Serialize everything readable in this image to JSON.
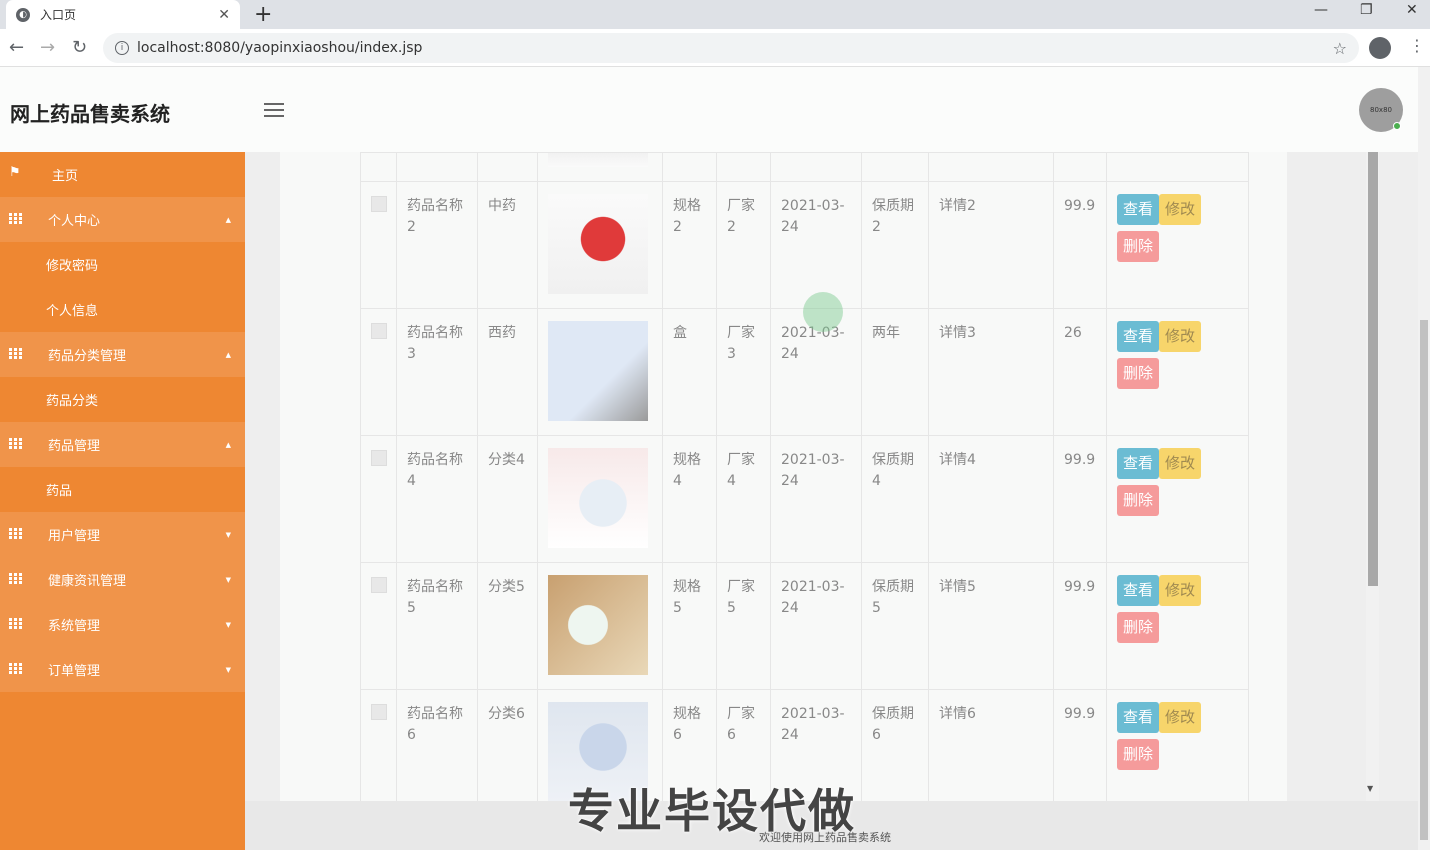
{
  "browser": {
    "tab_title": "入口页",
    "url": "localhost:8080/yaopinxiaoshou/index.jsp"
  },
  "header": {
    "app_title": "网上药品售卖系统",
    "avatar_text": "80x80"
  },
  "sidebar": {
    "items": [
      {
        "label": "主页",
        "type": "home"
      },
      {
        "label": "个人中心",
        "type": "group",
        "expanded": true
      },
      {
        "label": "修改密码",
        "type": "sub"
      },
      {
        "label": "个人信息",
        "type": "sub"
      },
      {
        "label": "药品分类管理",
        "type": "group",
        "expanded": true
      },
      {
        "label": "药品分类",
        "type": "sub"
      },
      {
        "label": "药品管理",
        "type": "group",
        "expanded": true
      },
      {
        "label": "药品",
        "type": "sub"
      },
      {
        "label": "用户管理",
        "type": "group",
        "expanded": false
      },
      {
        "label": "健康资讯管理",
        "type": "group",
        "expanded": false
      },
      {
        "label": "系统管理",
        "type": "group",
        "expanded": false
      },
      {
        "label": "订单管理",
        "type": "group",
        "expanded": false
      }
    ]
  },
  "table": {
    "buttons": {
      "view": "查看",
      "edit": "修改",
      "delete": "删除"
    },
    "rows": [
      {
        "name": "药品名称2",
        "category": "中药",
        "spec": "规格2",
        "maker": "厂家2",
        "date": "2021-03-24",
        "shelf": "保质期2",
        "detail": "详情2",
        "price": "99.9"
      },
      {
        "name": "药品名称3",
        "category": "西药",
        "spec": "盒",
        "maker": "厂家3",
        "date": "2021-03-24",
        "shelf": "两年",
        "detail": "详情3",
        "price": "26"
      },
      {
        "name": "药品名称4",
        "category": "分类4",
        "spec": "规格4",
        "maker": "厂家4",
        "date": "2021-03-24",
        "shelf": "保质期4",
        "detail": "详情4",
        "price": "99.9"
      },
      {
        "name": "药品名称5",
        "category": "分类5",
        "spec": "规格5",
        "maker": "厂家5",
        "date": "2021-03-24",
        "shelf": "保质期5",
        "detail": "详情5",
        "price": "99.9"
      },
      {
        "name": "药品名称6",
        "category": "分类6",
        "spec": "规格6",
        "maker": "厂家6",
        "date": "2021-03-24",
        "shelf": "保质期6",
        "detail": "详情6",
        "price": "99.9"
      }
    ]
  },
  "footer": {
    "text": "欢迎使用网上药品售卖系统",
    "watermark": "专业毕设代做"
  }
}
